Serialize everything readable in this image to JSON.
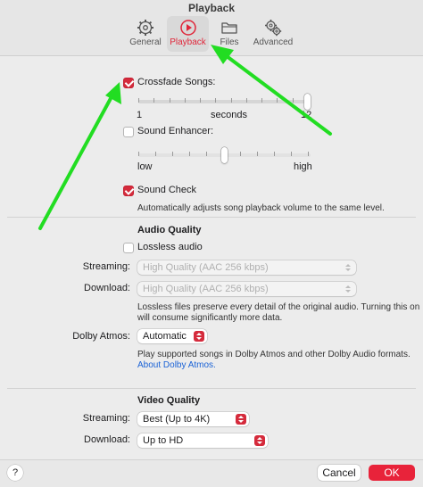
{
  "window": {
    "title": "Playback"
  },
  "tabs": [
    {
      "label": "General",
      "icon": "gear-icon"
    },
    {
      "label": "Playback",
      "icon": "play-circle-icon",
      "active": true
    },
    {
      "label": "Files",
      "icon": "folder-icon"
    },
    {
      "label": "Advanced",
      "icon": "gears-icon"
    }
  ],
  "crossfade": {
    "label": "Crossfade Songs:",
    "checked": true,
    "min_label": "1",
    "unit_label": "seconds",
    "max_label": "12",
    "value_fraction": 1.0
  },
  "enhancer": {
    "label": "Sound Enhancer:",
    "checked": false,
    "low_label": "low",
    "high_label": "high",
    "value_fraction": 0.5
  },
  "sound_check": {
    "label": "Sound Check",
    "checked": true,
    "description": "Automatically adjusts song playback volume to the same level."
  },
  "audio_quality": {
    "heading": "Audio Quality",
    "lossless_label": "Lossless audio",
    "lossless_checked": false,
    "streaming_label": "Streaming:",
    "streaming_value": "High Quality (AAC 256 kbps)",
    "download_label": "Download:",
    "download_value": "High Quality (AAC 256 kbps)",
    "note_line1": "Lossless files preserve every detail of the original audio. Turning this on",
    "note_line2": "will consume significantly more data."
  },
  "dolby": {
    "label": "Dolby Atmos:",
    "value": "Automatic",
    "desc": "Play supported songs in Dolby Atmos and other Dolby Audio formats.",
    "link": "About Dolby Atmos."
  },
  "video_quality": {
    "heading": "Video Quality",
    "streaming_label": "Streaming:",
    "streaming_value": "Best (Up to 4K)",
    "download_label": "Download:",
    "download_value": "Up to HD"
  },
  "footer": {
    "help": "?",
    "cancel": "Cancel",
    "ok": "OK"
  },
  "colors": {
    "accent": "#d52b3c",
    "annotation_arrow": "#22dd22",
    "link": "#1a62d6"
  }
}
